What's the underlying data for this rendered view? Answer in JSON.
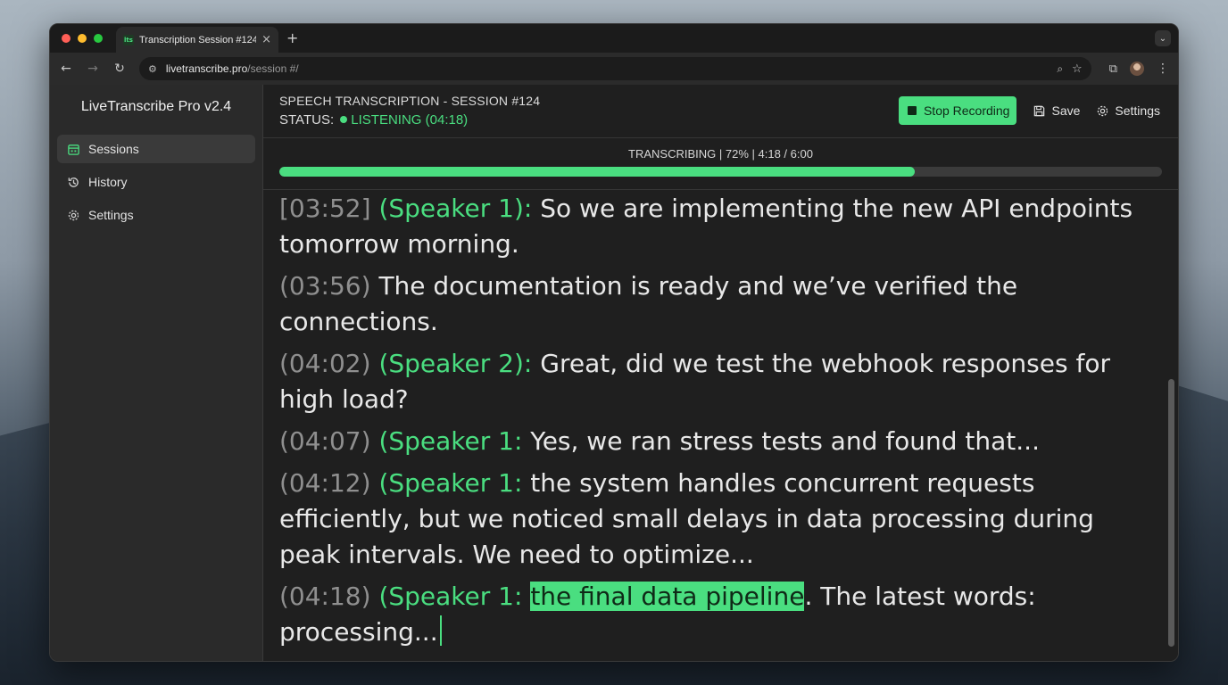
{
  "browser": {
    "tab_title": "Transcription Session #124 - ",
    "favicon_text": "lts",
    "url_host": "livetranscribe.pro",
    "url_path": "/session #/"
  },
  "sidebar": {
    "brand": "LiveTranscribe Pro v2.4",
    "items": [
      {
        "label": "Sessions",
        "icon": "calendar-icon",
        "active": true
      },
      {
        "label": "History",
        "icon": "history-icon",
        "active": false
      },
      {
        "label": "Settings",
        "icon": "gear-icon",
        "active": false
      }
    ]
  },
  "header": {
    "title": "SPEECH TRANSCRIPTION - SESSION #124",
    "status_label": "STATUS:",
    "status_value": "LISTENING (04:18)",
    "stop_label": "Stop Recording",
    "save_label": "Save",
    "settings_label": "Settings"
  },
  "progress": {
    "label": "TRANSCRIBING | 72% | 4:18 / 6:00",
    "percent": 72
  },
  "transcript": [
    {
      "ts": "[03:52]",
      "speaker": " (Speaker 1): ",
      "text": " So we are implementing the new API endpoints tomorrow morning."
    },
    {
      "ts": "(03:56)",
      "speaker": "",
      "text": " The documentation is ready and we’ve verified the connections."
    },
    {
      "ts": "(04:02)",
      "speaker": " (Speaker 2):",
      "text": " Great, did we test the webhook responses for high load?"
    },
    {
      "ts": "(04:07)",
      "speaker": " (Speaker 1:",
      "text": " Yes, we ran stress tests and found that..."
    },
    {
      "ts": "(04:12)",
      "speaker": " (Speaker 1:",
      "text": " the system handles concurrent requests efficiently, but we noticed small delays in data processing during peak intervals. We need to optimize..."
    },
    {
      "ts": "(04:18)",
      "speaker": " (Speaker 1: ",
      "highlight": "the final data pipeline",
      "text": ". The latest words: processing..."
    }
  ],
  "colors": {
    "accent": "#4ade80",
    "timestamp": "#8f8f8f",
    "text": "#e8e8e8"
  }
}
